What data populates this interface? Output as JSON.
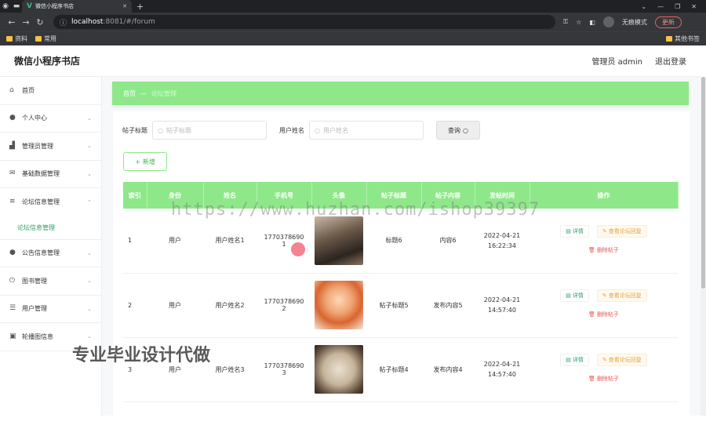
{
  "browser": {
    "tab_title": "微信小程序书店",
    "url_host": "localhost",
    "url_path": ":8081/#/forum",
    "incognito_label": "无痕模式",
    "update_label": "更新",
    "bookmarks": [
      "资料",
      "常用"
    ],
    "bookmarks_right": "其他书签"
  },
  "header": {
    "brand": "微信小程序书店",
    "user": "管理员 admin",
    "logout": "退出登录"
  },
  "sidebar": {
    "items": [
      {
        "label": "首页",
        "icon": "home-icon"
      },
      {
        "label": "个人中心",
        "icon": "user-icon"
      },
      {
        "label": "管理员管理",
        "icon": "chart-icon"
      },
      {
        "label": "基础数据管理",
        "icon": "mail-icon"
      },
      {
        "label": "论坛信息管理",
        "icon": "list-icon"
      },
      {
        "label": "论坛信息管理",
        "icon": ""
      },
      {
        "label": "公告信息管理",
        "icon": "user-icon"
      },
      {
        "label": "图书管理",
        "icon": "power-icon"
      },
      {
        "label": "用户管理",
        "icon": "sliders-icon"
      },
      {
        "label": "轮播图信息",
        "icon": "image-icon"
      }
    ]
  },
  "breadcrumb": {
    "home": "首页",
    "sep": "—",
    "current": "论坛管理"
  },
  "search": {
    "title_label": "帖子标题",
    "title_placeholder": "帖子标题",
    "user_label": "用户姓名",
    "user_placeholder": "用户姓名",
    "query_button": "查询"
  },
  "add_button": "新增",
  "table": {
    "headers": [
      "索引",
      "身份",
      "姓名",
      "手机号",
      "头像",
      "帖子标题",
      "帖子内容",
      "发帖时间",
      "操作"
    ],
    "rows": [
      {
        "index": "1",
        "role": "用户",
        "name": "用户姓名1",
        "phone": "17703786901",
        "title": "标题6",
        "content": "内容6",
        "date": "2022-04-21",
        "time": "16:22:34"
      },
      {
        "index": "2",
        "role": "用户",
        "name": "用户姓名2",
        "phone": "17703786902",
        "title": "帖子标题5",
        "content": "发布内容5",
        "date": "2022-04-21",
        "time": "14:57:40"
      },
      {
        "index": "3",
        "role": "用户",
        "name": "用户姓名3",
        "phone": "17703786903",
        "title": "帖子标题4",
        "content": "发布内容4",
        "date": "2022-04-21",
        "time": "14:57:40"
      }
    ],
    "ops": {
      "detail": "详情",
      "view": "查看论坛回复",
      "delete": "删除帖子"
    }
  },
  "watermarks": {
    "url": "https://www.huzhan.com/ishop39397",
    "cn": "专业毕业设计代做"
  }
}
